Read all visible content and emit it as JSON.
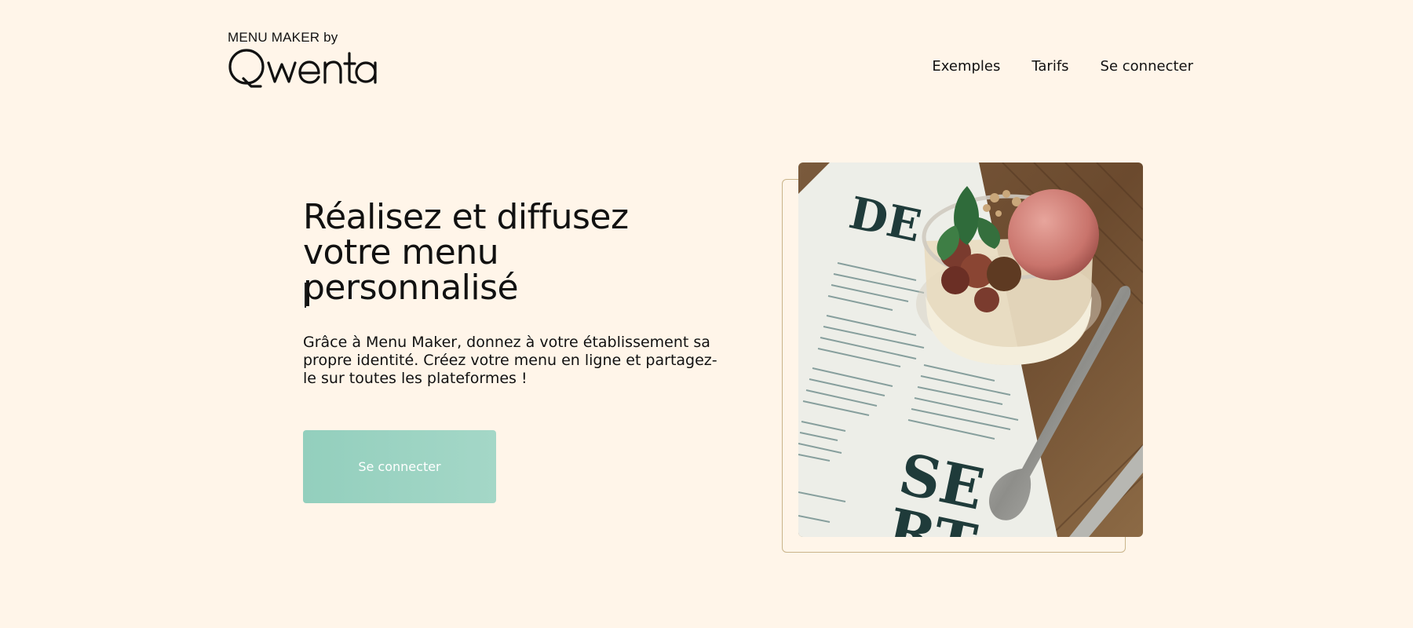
{
  "header": {
    "logo_tagline": "MENU MAKER by",
    "logo_wordmark": "Qwenta",
    "nav": [
      {
        "label": "Exemples"
      },
      {
        "label": "Tarifs"
      },
      {
        "label": "Se connecter"
      }
    ]
  },
  "hero": {
    "title": "Réalisez et diffusez votre menu personnalisé",
    "description": "Grâce à Menu Maker, donnez à votre établissement sa propre identité. Créez votre menu en ligne et partagez-le sur toutes les plateformes !",
    "cta_label": "Se connecter"
  },
  "image": {
    "alt": "dessert-menu-photo"
  },
  "colors": {
    "background": "#FFF5E9",
    "accent": "#9ED5C5",
    "frame_border": "#C9B48A",
    "text": "#111111"
  }
}
